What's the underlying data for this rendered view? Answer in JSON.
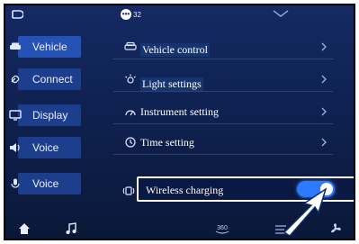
{
  "status_bar": {
    "message_count": "32"
  },
  "sidebar": {
    "items": [
      {
        "label": "Vehicle",
        "icon": "car-icon"
      },
      {
        "label": "Connect",
        "icon": "link-icon"
      },
      {
        "label": "Display",
        "icon": "display-icon"
      },
      {
        "label": "Voice",
        "icon": "speaker-icon"
      },
      {
        "label": "Voice",
        "icon": "microphone-icon"
      }
    ]
  },
  "settings_list": {
    "rows": [
      {
        "label": "Vehicle control",
        "icon": "car-icon"
      },
      {
        "label": "Light settings",
        "icon": "light-icon"
      },
      {
        "label": "Instrument setting",
        "icon": "gauge-icon"
      },
      {
        "label": "Time setting",
        "icon": "clock-icon"
      },
      {
        "label": "Wireless charging",
        "icon": "wireless-charging-icon",
        "toggle_on": true
      }
    ]
  },
  "dock": {
    "icons": [
      "home-icon",
      "music-icon",
      "360-camera-icon",
      "climate-icon",
      "fan-icon"
    ]
  },
  "colors": {
    "background": "#10224f",
    "accent": "#2d79ff",
    "sidebar_pill": "#1c3e8c"
  }
}
